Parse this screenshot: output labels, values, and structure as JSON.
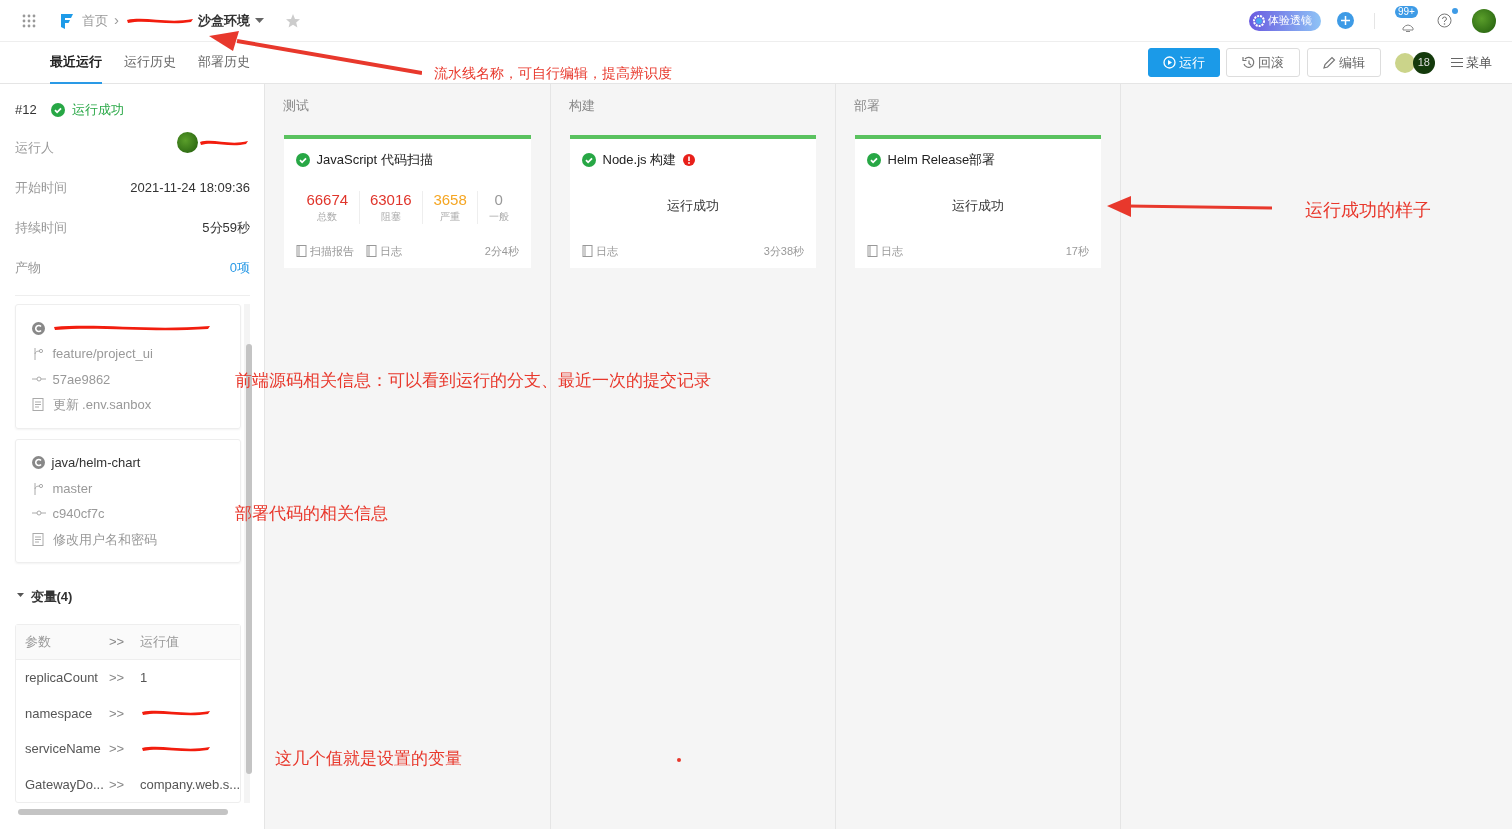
{
  "header": {
    "breadcrumb_home": "首页",
    "breadcrumb_separator": "›",
    "pipeline_name": "沙盒环境",
    "pipeline_name_redacted": true,
    "lens_badge": "体验透镜",
    "notification_count": "99+",
    "help_dot": true
  },
  "tabs": [
    {
      "label": "最近运行",
      "selected": true
    },
    {
      "label": "运行历史",
      "selected": false
    },
    {
      "label": "部署历史",
      "selected": false
    }
  ],
  "actions": [
    {
      "label": "运行",
      "kind": "primary"
    },
    {
      "label": "回滚",
      "kind": "history"
    },
    {
      "label": "编辑",
      "kind": "edit"
    }
  ],
  "member_count": "18",
  "menu_label": "菜单",
  "run": {
    "number": "#12",
    "status": "运行成功",
    "success": true,
    "fields": [
      {
        "label": "运行人",
        "kind": "user",
        "redacted": true
      },
      {
        "label": "开始时间",
        "value": "2021-11-24 18:09:36",
        "kind": "text"
      },
      {
        "label": "持续时间",
        "value": "5分59秒",
        "kind": "text"
      },
      {
        "label": "产物",
        "value": "0项",
        "kind": "link"
      }
    ]
  },
  "sources": [
    {
      "repo_redacted": true,
      "branch": "feature/project_ui",
      "commit": "57ae9862",
      "message": "更新 .env.sanbox"
    },
    {
      "repo": "java/helm-chart",
      "repo_redacted": false,
      "branch": "master",
      "commit": "c940cf7c",
      "message": "修改用户名和密码"
    }
  ],
  "variables": {
    "title": "变量(4)",
    "expanded": true,
    "header": [
      "参数",
      ">>",
      "运行值"
    ],
    "rows": [
      {
        "name": "replicaCount",
        "sep": ">>",
        "value": "1",
        "redacted": false
      },
      {
        "name": "namespace",
        "sep": ">>",
        "redacted": true
      },
      {
        "name": "serviceName",
        "sep": ">>",
        "redacted": true
      },
      {
        "name": "GatewayDo...",
        "sep": ">>",
        "value": "company.web.s...",
        "redacted": false
      }
    ]
  },
  "stages": [
    {
      "title": "测试",
      "jobs": [
        {
          "name": "JavaScript 代码扫描",
          "success": true,
          "warning": false,
          "kind": "scan",
          "stats": [
            {
              "value": "66674",
              "label": "总数",
              "color": "#e0352b"
            },
            {
              "value": "63016",
              "label": "阻塞",
              "color": "#e0352b"
            },
            {
              "value": "3658",
              "label": "严重",
              "color": "#f5a623"
            },
            {
              "value": "0",
              "label": "一般",
              "color": "#999999"
            }
          ],
          "links": [
            "扫描报告",
            "日志"
          ],
          "duration": "2分4秒"
        }
      ]
    },
    {
      "title": "构建",
      "jobs": [
        {
          "name": "Node.js 构建",
          "success": true,
          "warning": true,
          "kind": "summary",
          "summary": "运行成功",
          "links": [
            "日志"
          ],
          "duration": "3分38秒"
        }
      ]
    },
    {
      "title": "部署",
      "jobs": [
        {
          "name": "Helm Release部署",
          "success": true,
          "warning": false,
          "kind": "summary",
          "summary": "运行成功",
          "links": [
            "日志"
          ],
          "duration": "17秒"
        }
      ]
    }
  ],
  "annotations": [
    {
      "text": "流水线名称，可自行编辑，提高辨识度",
      "kind": "arrow"
    },
    {
      "text": "运行成功的样子",
      "kind": "arrow"
    },
    {
      "text": "前端源码相关信息：可以看到运行的分支、最近一次的提交记录",
      "kind": "plain"
    },
    {
      "text": "部署代码的相关信息",
      "kind": "plain"
    },
    {
      "text": "这几个值就是设置的变量",
      "kind": "plain"
    }
  ]
}
